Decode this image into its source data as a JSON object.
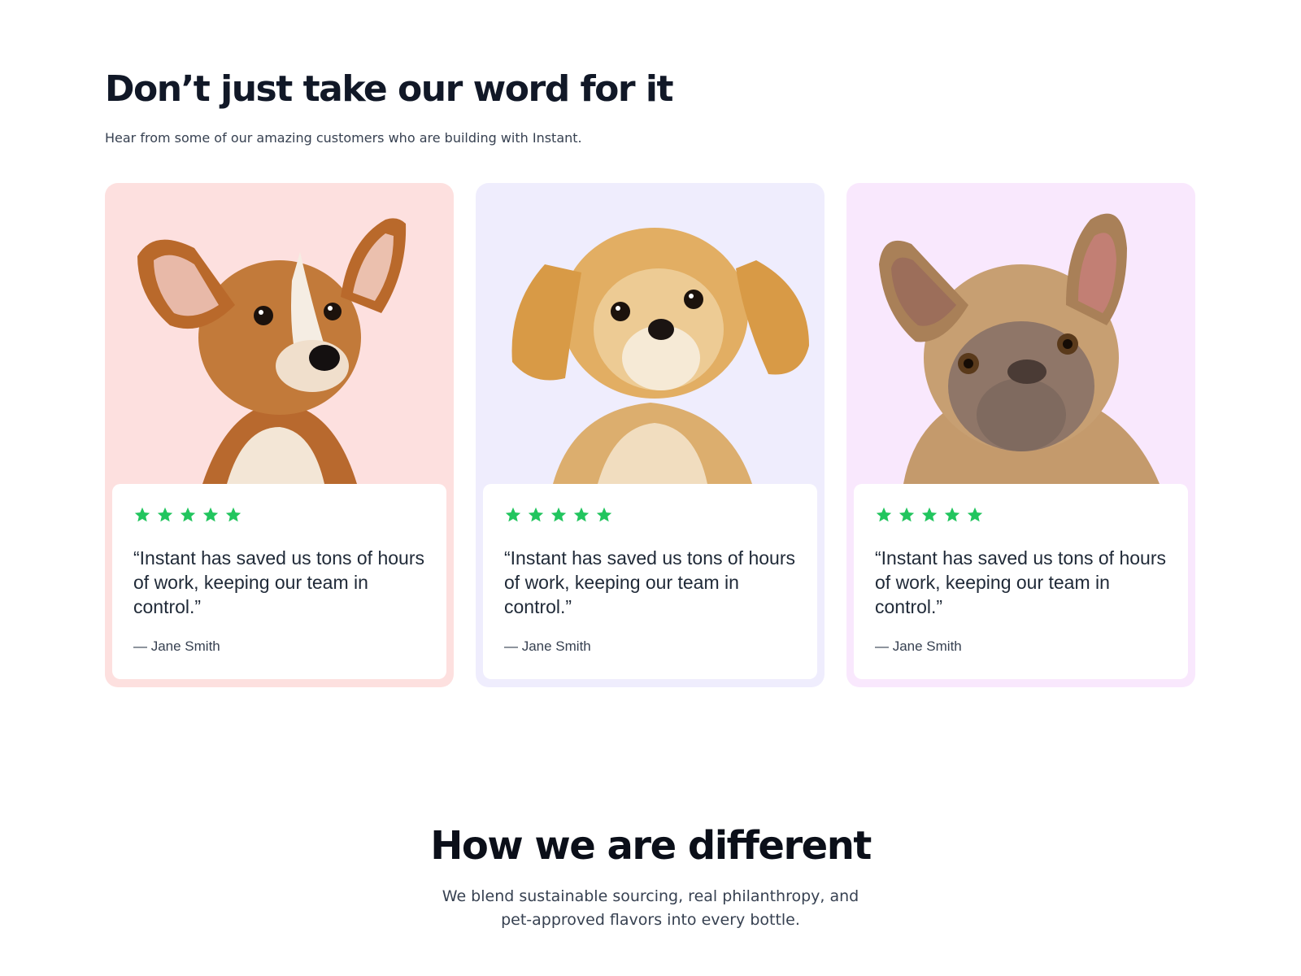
{
  "testimonials": {
    "title": "Don’t just take our word for it",
    "subtitle": "Hear from some of our amazing customers who are building with Instant.",
    "cards": [
      {
        "background": "#fde0df",
        "image": "corgi-puppy-photo",
        "rating": 5,
        "quote": "“Instant has saved us tons of hours of work, keeping our team in control.”",
        "author": "— Jane Smith"
      },
      {
        "background": "#efedfd",
        "image": "shih-tzu-dog-photo",
        "rating": 5,
        "quote": "“Instant has saved us tons of hours of work, keeping our team in control.”",
        "author": "— Jane Smith"
      },
      {
        "background": "#f9e8fd",
        "image": "french-bulldog-photo",
        "rating": 5,
        "quote": "“Instant has saved us tons of hours of work, keeping our team in control.”",
        "author": "— Jane Smith"
      }
    ],
    "star_color": "#22c55e"
  },
  "different": {
    "title": "How we are different",
    "subtitle": "We blend sustainable sourcing, real philanthropy, and pet-approved flavors into every bottle."
  }
}
